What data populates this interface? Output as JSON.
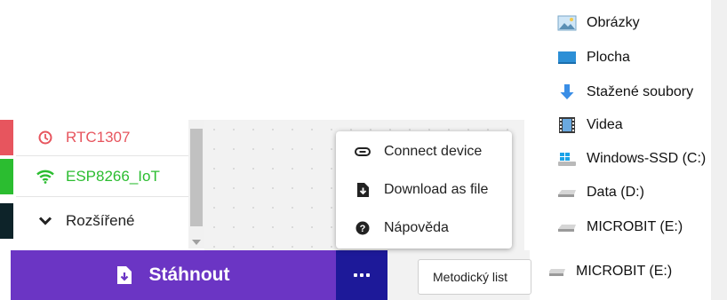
{
  "categories": [
    {
      "label": "RTC1307",
      "color": "#e7555e",
      "text_color": "#e7555e",
      "icon": "clock-icon"
    },
    {
      "label": "ESP8266_IoT",
      "color": "#2bbd30",
      "text_color": "#2bbd30",
      "icon": "wifi-icon"
    },
    {
      "label": "Rozšířené",
      "color": "#0d2329",
      "text_color": "#222222",
      "icon": "chevron-down-icon"
    }
  ],
  "download": {
    "label": "Stáhnout",
    "icon": "file-download-icon"
  },
  "more": {
    "icon": "ellipsis-icon"
  },
  "metodicky": {
    "label": "Metodický list"
  },
  "context_menu": [
    {
      "label": "Connect device",
      "icon": "link-icon"
    },
    {
      "label": "Download as file",
      "icon": "file-download-icon"
    },
    {
      "label": "Nápověda",
      "icon": "help-circle-icon"
    }
  ],
  "explorer": [
    {
      "label": "Obrázky",
      "icon": "pictures-folder-icon"
    },
    {
      "label": "Plocha",
      "icon": "desktop-folder-icon"
    },
    {
      "label": "Stažené soubory",
      "icon": "downloads-folder-icon"
    },
    {
      "label": "Videa",
      "icon": "videos-folder-icon"
    },
    {
      "label": "Windows-SSD (C:)",
      "icon": "windows-drive-icon"
    },
    {
      "label": "Data (D:)",
      "icon": "drive-icon"
    },
    {
      "label": "MICROBIT (E:)",
      "icon": "drive-icon"
    },
    {
      "label": "MICROBIT (E:)",
      "icon": "drive-icon"
    }
  ]
}
